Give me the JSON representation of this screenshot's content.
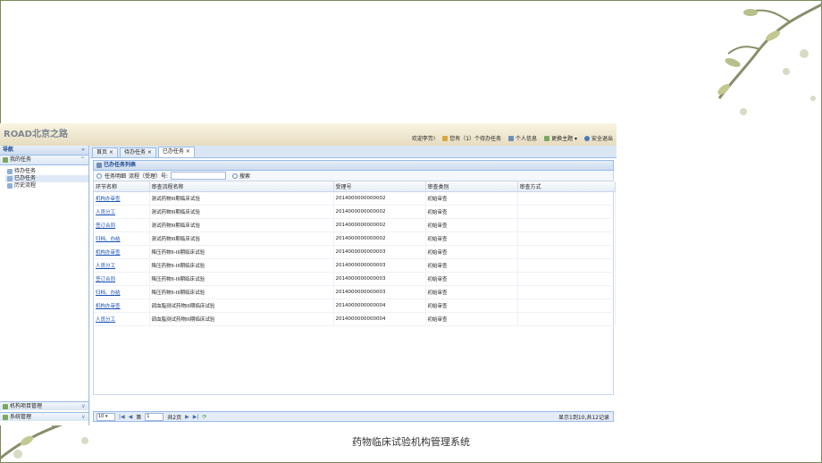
{
  "caption": "药物临床试验机构管理系统",
  "app": {
    "logo_brand": "ROAD",
    "logo_text": "北京之路",
    "topnav": {
      "welcome": "欢迎李芳!",
      "tasks": "您有（1）个待办任务",
      "profile": "个人信息",
      "theme": "更换主题 ▾",
      "logout": "安全退出"
    },
    "left": {
      "nav_title": "导航",
      "section_title": "我的任务",
      "items": [
        "待办任务",
        "已办任务",
        "历史流程"
      ],
      "bottom1": "机构项目管理",
      "bottom2": "系统管理"
    },
    "tabs": [
      "首页 ×",
      "待办任务 ×",
      "已办任务 ×"
    ],
    "panel_title": "已办任务列表",
    "search": {
      "label1": "任务明细",
      "label2": "流程（受理）号:",
      "button": "搜索"
    },
    "columns": [
      "环节名称",
      "审查流程名称",
      "受理号",
      "审查类别",
      "审查方式"
    ],
    "rows": [
      [
        "机构办审查",
        "测试药物III期临床试验",
        "2014000000000002",
        "初始审查",
        ""
      ],
      [
        "人员分工",
        "测试药物III期临床试验",
        "2014000000000002",
        "初始审查",
        ""
      ],
      [
        "签订合同",
        "测试药物III期临床试验",
        "2014000000000002",
        "初始审查",
        ""
      ],
      [
        "归档、办结",
        "测试药物III期临床试验",
        "2014000000000002",
        "初始审查",
        ""
      ],
      [
        "机构办审查",
        "降压药物II-III期临床试验",
        "2014000000000003",
        "初始审查",
        ""
      ],
      [
        "人员分工",
        "降压药物II-III期临床试验",
        "2014000000000003",
        "初始审查",
        ""
      ],
      [
        "签订合同",
        "降压药物II-III期临床试验",
        "2014000000000003",
        "初始审查",
        ""
      ],
      [
        "归档、办结",
        "降压药物II-III期临床试验",
        "2014000000000003",
        "初始审查",
        ""
      ],
      [
        "机构办审查",
        "调血脂测试药物III期临床试验",
        "2014000000000004",
        "初始审查",
        ""
      ],
      [
        "人员分工",
        "调血脂测试药物III期临床试验",
        "2014000000000004",
        "初始审查",
        ""
      ]
    ],
    "pager": {
      "page_size": "10 ▾",
      "page_prefix": "第",
      "page_value": "1",
      "page_suffix": "共2页",
      "info": "显示1到10,共12记录"
    }
  }
}
